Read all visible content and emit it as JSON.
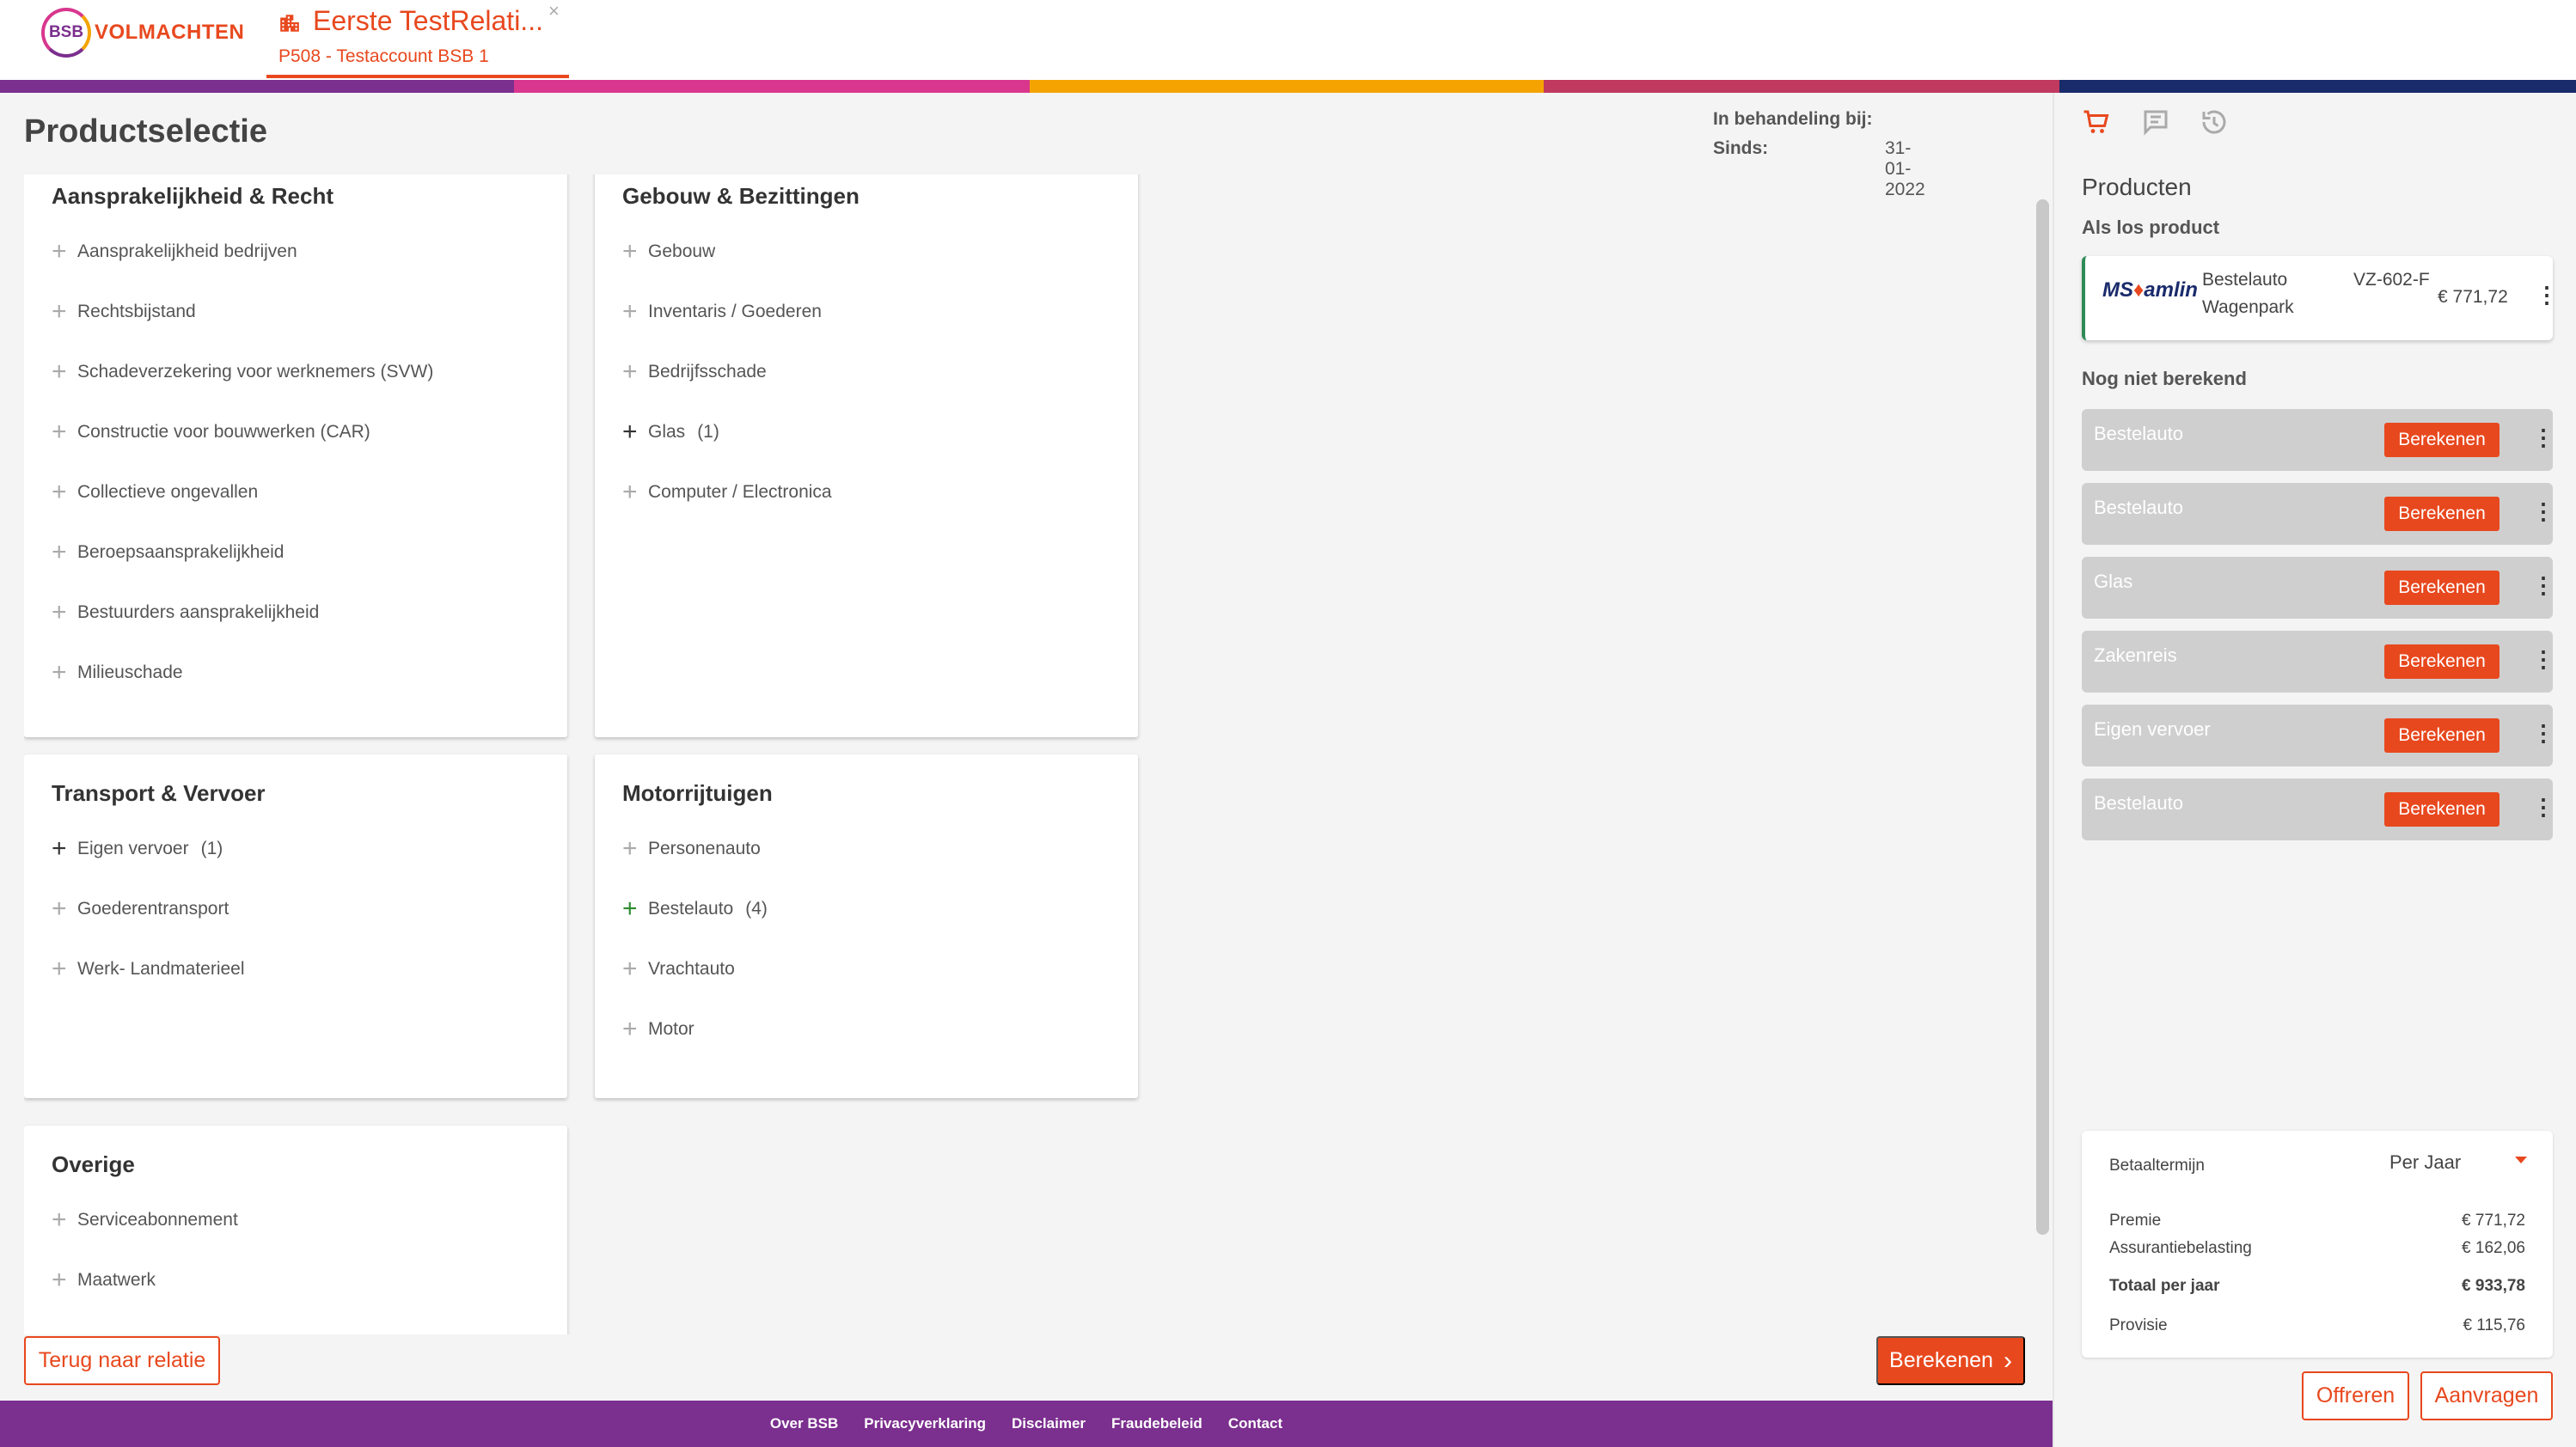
{
  "header": {
    "logo_mark": "BSB",
    "logo_text": "VOLMACHTEN",
    "tab_title": "Eerste TestRelati...",
    "tab_subtitle": "P508 - Testaccount BSB 1",
    "tab_close": "×",
    "stripe_colors": [
      "#7b2f8e",
      "#d9368e",
      "#f4a300",
      "#c0395e",
      "#1a2b6b"
    ]
  },
  "main": {
    "title": "Productselectie",
    "in_behandeling_label": "In behandeling bij:",
    "since_label": "Sinds:",
    "since_value": "31-01-2022",
    "cards": [
      {
        "title": "Aansprakelijkheid & Recht",
        "items": [
          {
            "label": "Aansprakelijkheid bedrijven",
            "count": "",
            "state": "default"
          },
          {
            "label": "Rechtsbijstand",
            "count": "",
            "state": "default"
          },
          {
            "label": "Schadeverzekering voor werknemers (SVW)",
            "count": "",
            "state": "default"
          },
          {
            "label": "Constructie voor bouwwerken (CAR)",
            "count": "",
            "state": "default"
          },
          {
            "label": "Collectieve ongevallen",
            "count": "",
            "state": "default"
          },
          {
            "label": "Beroepsaansprakelijkheid",
            "count": "",
            "state": "default"
          },
          {
            "label": "Bestuurders aansprakelijkheid",
            "count": "",
            "state": "default"
          },
          {
            "label": "Milieuschade",
            "count": "",
            "state": "default"
          }
        ]
      },
      {
        "title": "Gebouw & Bezittingen",
        "items": [
          {
            "label": "Gebouw",
            "count": "",
            "state": "default"
          },
          {
            "label": "Inventaris / Goederen",
            "count": "",
            "state": "default"
          },
          {
            "label": "Bedrijfsschade",
            "count": "",
            "state": "default"
          },
          {
            "label": "Glas",
            "count": "(1)",
            "state": "dark"
          },
          {
            "label": "Computer / Electronica",
            "count": "",
            "state": "default"
          }
        ]
      },
      {
        "title": "Transport & Vervoer",
        "items": [
          {
            "label": "Eigen vervoer",
            "count": "(1)",
            "state": "dark"
          },
          {
            "label": "Goederentransport",
            "count": "",
            "state": "default"
          },
          {
            "label": "Werk- Landmaterieel",
            "count": "",
            "state": "default"
          }
        ]
      },
      {
        "title": "Motorrijtuigen",
        "items": [
          {
            "label": "Personenauto",
            "count": "",
            "state": "default"
          },
          {
            "label": "Bestelauto",
            "count": "(4)",
            "state": "green"
          },
          {
            "label": "Vrachtauto",
            "count": "",
            "state": "default"
          },
          {
            "label": "Motor",
            "count": "",
            "state": "default"
          }
        ]
      },
      {
        "title": "Overige",
        "items": [
          {
            "label": "Serviceabonnement",
            "count": "",
            "state": "default"
          },
          {
            "label": "Maatwerk",
            "count": "",
            "state": "default"
          }
        ]
      }
    ],
    "back_button": "Terug naar relatie",
    "calc_button": "Berekenen",
    "calc_chevron": "›"
  },
  "footer": {
    "links": [
      "Over BSB",
      "Privacyverklaring",
      "Disclaimer",
      "Fraudebeleid",
      "Contact"
    ]
  },
  "sidebar": {
    "icons": [
      "cart-icon",
      "comment-icon",
      "history-icon"
    ],
    "heading": "Producten",
    "loose_label": "Als los product",
    "product": {
      "brand_ms": "MS",
      "brand_amlin": "amlin",
      "line1": "Bestelauto",
      "line2": "Wagenpark",
      "plate": "VZ-602-F",
      "price": "€ 771,72"
    },
    "not_calculated_label": "Nog niet berekend",
    "pending": [
      {
        "label": "Bestelauto",
        "button": "Berekenen"
      },
      {
        "label": "Bestelauto",
        "button": "Berekenen"
      },
      {
        "label": "Glas",
        "button": "Berekenen"
      },
      {
        "label": "Zakenreis",
        "button": "Berekenen"
      },
      {
        "label": "Eigen vervoer",
        "button": "Berekenen"
      },
      {
        "label": "Bestelauto",
        "button": "Berekenen"
      }
    ],
    "summary": {
      "term_label": "Betaaltermijn",
      "term_value": "Per Jaar",
      "premie_label": "Premie",
      "premie_value": "€ 771,72",
      "tax_label": "Assurantiebelasting",
      "tax_value": "€ 162,06",
      "total_label": "Totaal per jaar",
      "total_value": "€ 933,78",
      "provisie_label": "Provisie",
      "provisie_value": "€ 115,76"
    },
    "offer_button": "Offreren",
    "request_button": "Aanvragen"
  }
}
